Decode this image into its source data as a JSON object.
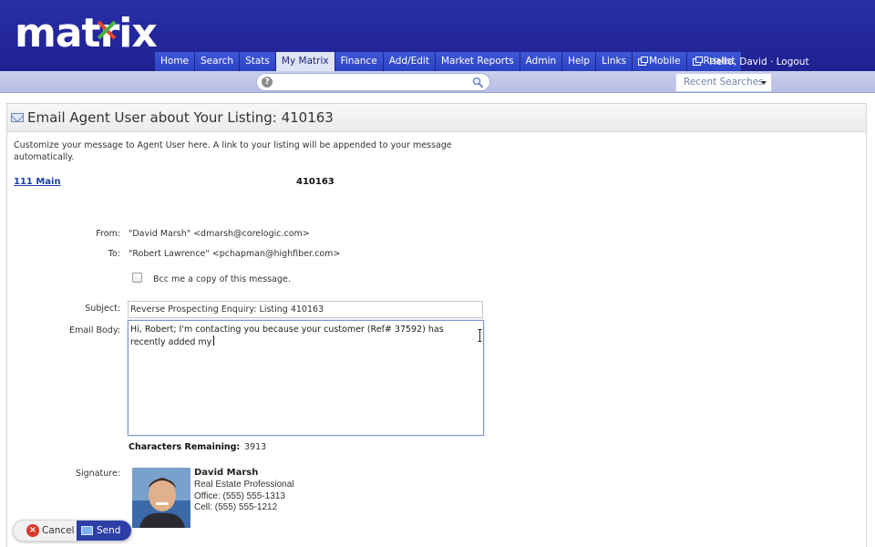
{
  "brand": {
    "logo_text": "matrix"
  },
  "nav": {
    "tabs": [
      {
        "label": "Home"
      },
      {
        "label": "Search"
      },
      {
        "label": "Stats"
      },
      {
        "label": "My Matrix",
        "active": true
      },
      {
        "label": "Finance"
      },
      {
        "label": "Add/Edit"
      },
      {
        "label": "Market Reports"
      },
      {
        "label": "Admin"
      },
      {
        "label": "Help"
      },
      {
        "label": "Links"
      },
      {
        "label": "Mobile",
        "icon": "external-window-icon"
      },
      {
        "label": "Realist",
        "icon": "external-window-icon"
      }
    ],
    "greeting": "Hello, David",
    "separator": " · ",
    "logout": "Logout"
  },
  "search": {
    "placeholder": "",
    "help_glyph": "?",
    "recent_searches_label": "Recent Searches"
  },
  "page": {
    "title": "Email Agent User about Your Listing: 410163",
    "intro": "Customize your message to Agent User here. A link to your listing will be appended to your message automatically.",
    "listing_link": "111 Main",
    "listing_number": "410163"
  },
  "form": {
    "from_label": "From:",
    "from_value": "\"David Marsh\" <dmarsh@corelogic.com>",
    "to_label": "To:",
    "to_value": "\"Robert Lawrence\" <pchapman@highfiber.com>",
    "bcc_label": "Bcc me a copy of this message.",
    "bcc_checked": false,
    "subject_label": "Subject:",
    "subject_value": "Reverse Prospecting Enquiry: Listing 410163",
    "body_label": "Email Body:",
    "body_value": "Hi, Robert; I'm contacting you because your customer (Ref# 37592) has recently added my",
    "chars_remaining_label": "Characters Remaining:",
    "chars_remaining_value": "3913"
  },
  "signature": {
    "label": "Signature:",
    "name": "David Marsh",
    "title": "Real Estate Professional",
    "office": "Office: (555) 555-1313",
    "cell": "Cell: (555) 555-1212"
  },
  "actions": {
    "cancel_label": "Cancel",
    "send_label": "Send"
  },
  "colors": {
    "header_blue": "#23279b",
    "tab_blue": "#2b43c4",
    "link_blue": "#1e3fa6",
    "send_blue": "#2d3fa7",
    "cancel_red": "#d8392b"
  }
}
